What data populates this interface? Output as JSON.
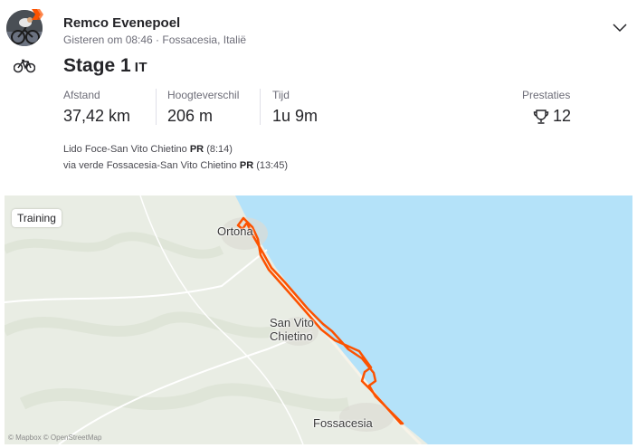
{
  "activity": {
    "athlete": "Remco Evenepoel",
    "meta": "Gisteren om 08:46 · Fossacesia, Italië",
    "title": "Stage 1",
    "title_suffix": "IT",
    "sport_icon": "bike-icon",
    "stats": [
      {
        "label": "Afstand",
        "value": "37,42 km"
      },
      {
        "label": "Hoogteverschil",
        "value": "206 m"
      },
      {
        "label": "Tijd",
        "value": "1u 9m"
      }
    ],
    "achievements": {
      "label": "Prestaties",
      "value": "12",
      "icon": "trophy-icon"
    },
    "segments": [
      {
        "name": "Lido Foce-San Vito Chietino",
        "pr": "PR",
        "time": "(8:14)"
      },
      {
        "name": "via verde Fossacesia-San Vito Chietino",
        "pr": "PR",
        "time": "(13:45)"
      }
    ]
  },
  "map": {
    "tag": "Training",
    "towns": [
      "Ortona",
      "San Vito",
      "Chietino",
      "Fossacesia"
    ],
    "credit": "© Mapbox © OpenStreetMap",
    "colors": {
      "route": "#fc5200",
      "sea": "#b4e2f9",
      "land": "#e9ede4"
    }
  }
}
